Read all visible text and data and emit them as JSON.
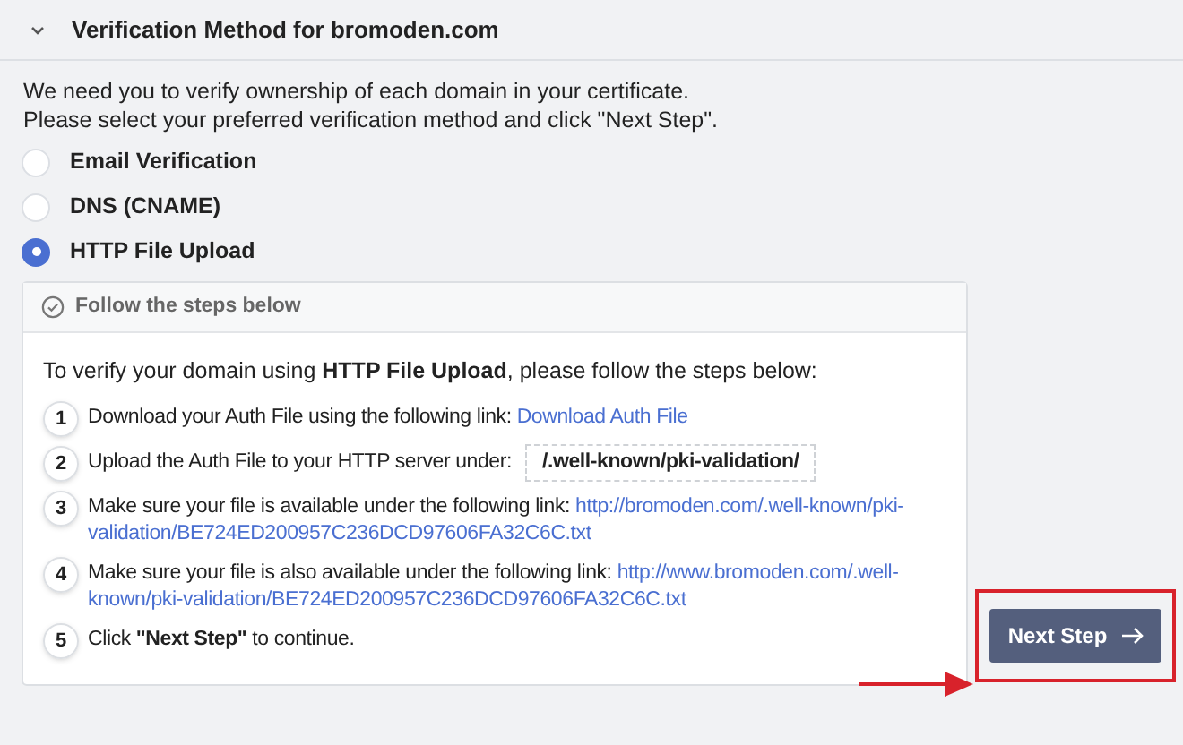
{
  "section": {
    "title": "Verification Method for bromoden.com",
    "expanded": true
  },
  "intro": [
    "We need you to verify ownership of each domain in your certificate.",
    "Please select your preferred verification method and click \"Next Step\"."
  ],
  "methods": [
    {
      "label": "Email Verification",
      "selected": false
    },
    {
      "label": "DNS (CNAME)",
      "selected": false
    },
    {
      "label": "HTTP File Upload",
      "selected": true
    }
  ],
  "steps_panel": {
    "title": "Follow the steps below",
    "lead": "To verify your domain using **HTTP File Upload**, please follow the steps below:",
    "steps": [
      {
        "number": "1",
        "kind": "link",
        "text": "Download your Auth File using the following link:",
        "link": "Download Auth File"
      },
      {
        "number": "2",
        "kind": "path",
        "text": "Upload the Auth File to your HTTP server under:",
        "path": "/.well-known/pki-validation/"
      },
      {
        "number": "3",
        "kind": "link",
        "text": "Make sure your file is available under the following link:",
        "link_lines": [
          "http://bromoden.com/.well-known/pki-",
          "validation/BE724ED200957C236DCD97606FA32C6C.txt"
        ]
      },
      {
        "number": "4",
        "kind": "link",
        "text": "Make sure your file is also available under the following link:",
        "link_lines": [
          "http://www.bromoden.com/.well-",
          "known/pki-validation/BE724ED200957C236DCD97606FA32C6C.txt"
        ]
      },
      {
        "number": "5",
        "kind": "plain",
        "text": "Click **\"Next Step\"** to continue."
      }
    ]
  },
  "next_button": {
    "label": "Next Step",
    "highlighted": true
  }
}
